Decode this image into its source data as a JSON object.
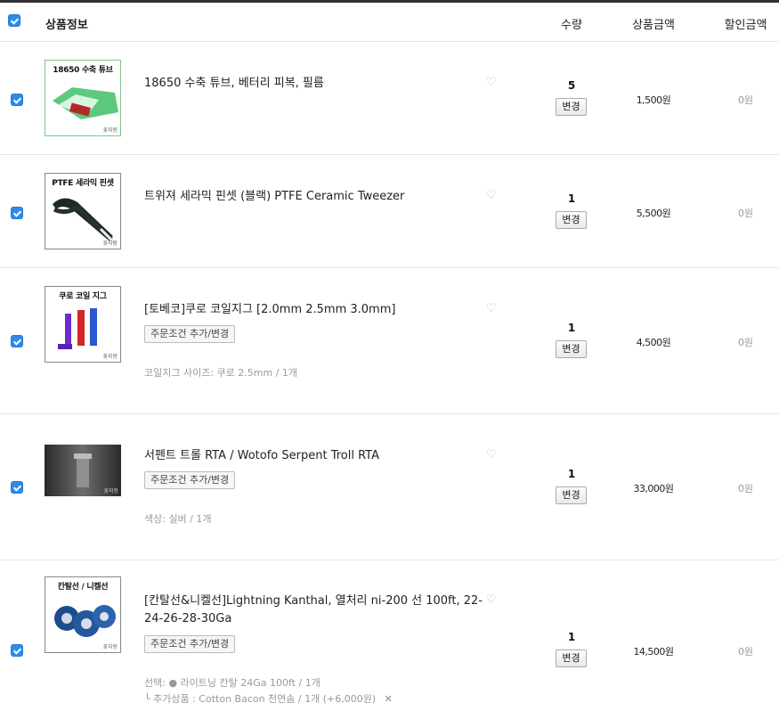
{
  "header": {
    "product_info": "상품정보",
    "quantity": "수량",
    "product_price": "상품금액",
    "discount": "할인금액"
  },
  "change_label": "변경",
  "option_button_label": "주문조건 추가/변경",
  "items": [
    {
      "thumb_label": "18650 수축 튜브",
      "thumb_brand": "꽃지랑",
      "name": "18650 수축 튜브, 베터리 피복, 필름",
      "quantity": "5",
      "price": "1,500원",
      "discount": "0원"
    },
    {
      "thumb_label": "PTFE 세라믹 핀셋",
      "thumb_brand": "꽃지랑",
      "name": "트위져 세라믹 핀셋 (블랙) PTFE Ceramic Tweezer",
      "quantity": "1",
      "price": "5,500원",
      "discount": "0원"
    },
    {
      "thumb_label": "쿠로 코일 지그",
      "thumb_brand": "꽃지랑",
      "name": "[토베코]쿠로 코일지그 [2.0mm 2.5mm 3.0mm]",
      "option": "코일지그 사이즈: 쿠로 2.5mm / 1개",
      "quantity": "1",
      "price": "4,500원",
      "discount": "0원"
    },
    {
      "thumb_label": "",
      "thumb_brand": "꽃지랑",
      "name": "서펜트 트롤 RTA / Wotofo Serpent Troll RTA",
      "option": "색상: 실버 / 1개",
      "quantity": "1",
      "price": "33,000원",
      "discount": "0원"
    },
    {
      "thumb_label": "칸탈선 / 니켈선",
      "thumb_brand": "꽃지랑",
      "name": "[칸탈선&니켈선]Lightning Kanthal, 열처리 ni-200 선 100ft, 22-24-26-28-30Ga",
      "option": "선택: ● 라이트닝 칸탈 24Ga 100ft / 1개",
      "addon": "└ 추가상품 : Cotton Bacon 천연솜 / 1개 (+6,000원)",
      "addon_remove": "✕",
      "quantity": "1",
      "price": "14,500원",
      "discount": "0원"
    }
  ],
  "colors": {
    "checkbox": "#2d8ce8",
    "border": "#e6e6e6"
  }
}
